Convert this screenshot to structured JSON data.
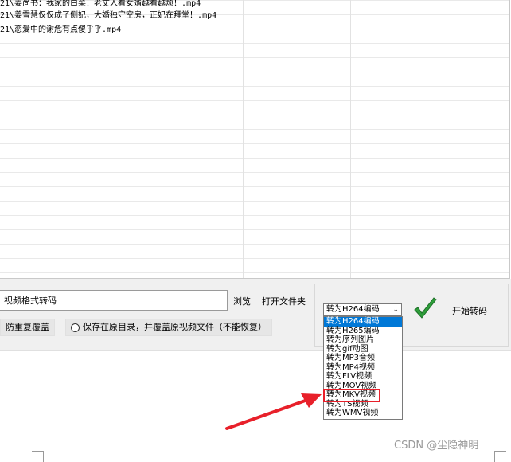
{
  "file_list": {
    "rows": [
      "21\\姜尚书：我家的白菜！老丈人看女婿越看越烦！.mp4",
      "21\\姜雪慧仅仅成了侧妃，大婚独守空房，正妃在拜堂！.mp4",
      "21\\恋爱中的谢危有点傻乎乎.mp4"
    ]
  },
  "panel": {
    "output_dir_value": "视频格式转码",
    "browse_label": "浏览",
    "open_folder_label": "打开文件夹",
    "prevent_overwrite_label": "防重复覆盖",
    "save_in_place_label": "保存在原目录，并覆盖原视频文件（不能恢复）"
  },
  "convert": {
    "selected": "转为H264编码",
    "options": [
      "转为H264编码",
      "转为H265编码",
      "转为序列图片",
      "转为gif动图",
      "转为MP3音频",
      "转为MP4视频",
      "转为FLV视频",
      "转为MOV视频",
      "转为MKV视频",
      "转为TS视频",
      "转为WMV视频"
    ],
    "start_label": "开始转码"
  },
  "colors": {
    "highlight": "#0078d7",
    "annotation_red": "#e8202a",
    "check_green": "#2e9e3a"
  },
  "watermark": "CSDN @尘隐神明"
}
